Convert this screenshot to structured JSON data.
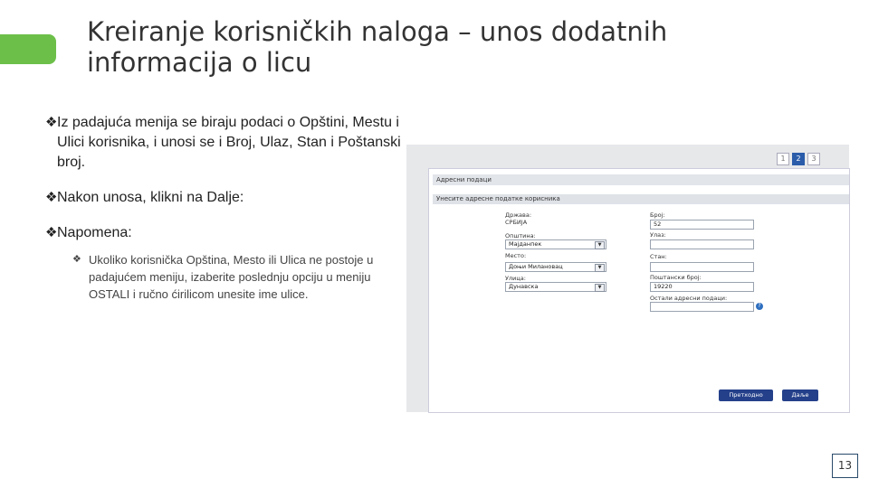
{
  "title": "Kreiranje korisničkih naloga – unos dodatnih informacija o licu",
  "bullets": [
    "Iz padajuća menija se biraju podaci o Opštini, Mestu i Ulici korisnika, i unosi se i Broj, Ulaz, Stan i Poštanski broj.",
    "Nakon unosa, klikni na Dalje:",
    "Napomena:"
  ],
  "sub_bullet": "Ukoliko korisnička Opština, Mesto ili Ulica ne postoje u padajućem meniju, izaberite poslednju opciju u meniju OSTALI i ručno ćirilicom unesite ime ulice.",
  "form": {
    "steps": [
      "1",
      "2",
      "3"
    ],
    "header": "Адресни подаци",
    "subheader": "Унесите адресне податке корисника",
    "drzava_label": "Држава:",
    "drzava_value": "СРБИЈА",
    "opstina_label": "Општина:",
    "opstina_value": "Мајданпек",
    "mesto_label": "Место:",
    "mesto_value": "Доњи Милановац",
    "ulica_label": "Улица:",
    "ulica_value": "Дунавска",
    "broj_label": "Број:",
    "broj_value": "52",
    "ulaz_label": "Улаз:",
    "ulaz_value": "",
    "stan_label": "Стан:",
    "stan_value": "",
    "postanski_label": "Поштански број:",
    "postanski_value": "19220",
    "ostali_label": "Остали адресни подаци:",
    "ostali_value": "",
    "help": "?",
    "back_button": "Претходно",
    "next_button": "Даље"
  },
  "page_number": "13",
  "colors": {
    "accent": "#6cc04a",
    "button": "#24408a"
  }
}
